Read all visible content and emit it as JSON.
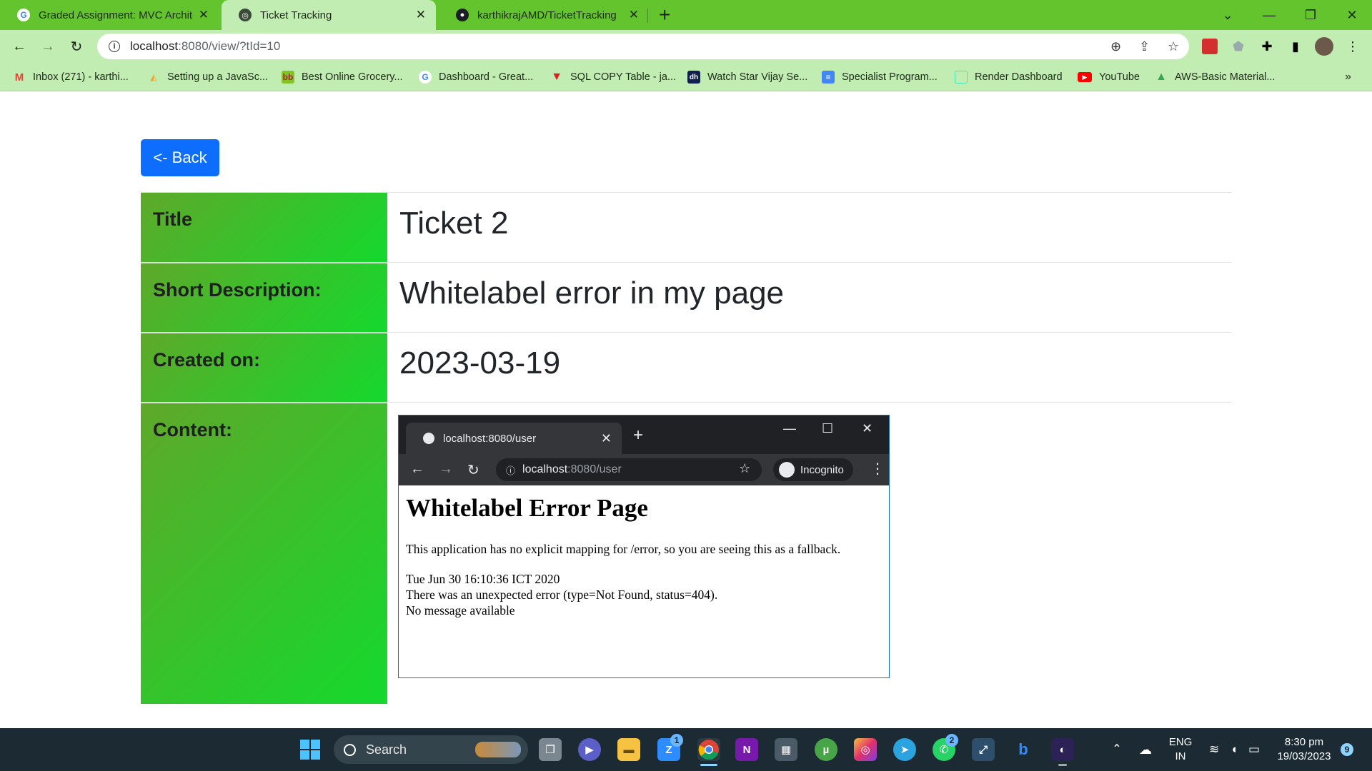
{
  "browser": {
    "tabs": [
      {
        "title": "Graded Assignment: MVC Archite",
        "favicon": "google-g-icon",
        "active": false
      },
      {
        "title": "Ticket Tracking",
        "favicon": "globe-icon",
        "active": true
      },
      {
        "title": "karthikrajAMD/TicketTracking",
        "favicon": "github-icon",
        "active": false
      }
    ],
    "url_host": "localhost",
    "url_rest": ":8080/view/?tId=10",
    "bookmarks": [
      {
        "label": "Inbox (271) - karthi...",
        "icon": "gmail-icon"
      },
      {
        "label": "Setting up a JavaSc...",
        "icon": "bookmark-icon"
      },
      {
        "label": "Best Online Grocery...",
        "icon": "bigbasket-icon"
      },
      {
        "label": "Dashboard - Great...",
        "icon": "google-g-icon"
      },
      {
        "label": "SQL COPY Table - ja...",
        "icon": "triangle-icon"
      },
      {
        "label": "Watch Star Vijay Se...",
        "icon": "hotstar-icon"
      },
      {
        "label": "Specialist Program...",
        "icon": "docs-icon"
      },
      {
        "label": "Render Dashboard",
        "icon": "render-icon"
      },
      {
        "label": "YouTube",
        "icon": "youtube-icon"
      },
      {
        "label": "AWS-Basic Material...",
        "icon": "drive-icon"
      }
    ]
  },
  "page": {
    "back_label": "<- Back",
    "rows": [
      {
        "label": "Title",
        "value": "Ticket 2"
      },
      {
        "label": "Short Description:",
        "value": "Whitelabel error in my page"
      },
      {
        "label": "Created on:",
        "value": "2023-03-19"
      },
      {
        "label": "Content:",
        "value": ""
      }
    ]
  },
  "embedded_screenshot": {
    "tab_title": "localhost:8080/user",
    "url_host": "localhost",
    "url_rest": ":8080/user",
    "incognito_label": "Incognito",
    "heading": "Whitelabel Error Page",
    "para1": "This application has no explicit mapping for /error, so you are seeing this as a fallback.",
    "line1": "Tue Jun 30 16:10:36 ICT 2020",
    "line2": "There was an unexpected error (type=Not Found, status=404).",
    "line3": "No message available"
  },
  "taskbar": {
    "search_label": "Search",
    "lang_top": "ENG",
    "lang_bottom": "IN",
    "time": "8:30 pm",
    "date": "19/03/2023",
    "notif_count": "9",
    "zoom_badge": "1",
    "whatsapp_badge": "2"
  },
  "colors": {
    "tab_strip": "#63c42d",
    "toolbar": "#c2edb2",
    "back_button": "#0d6efd",
    "label_gradient_start": "#5fa82a",
    "label_gradient_end": "#14d92c"
  }
}
